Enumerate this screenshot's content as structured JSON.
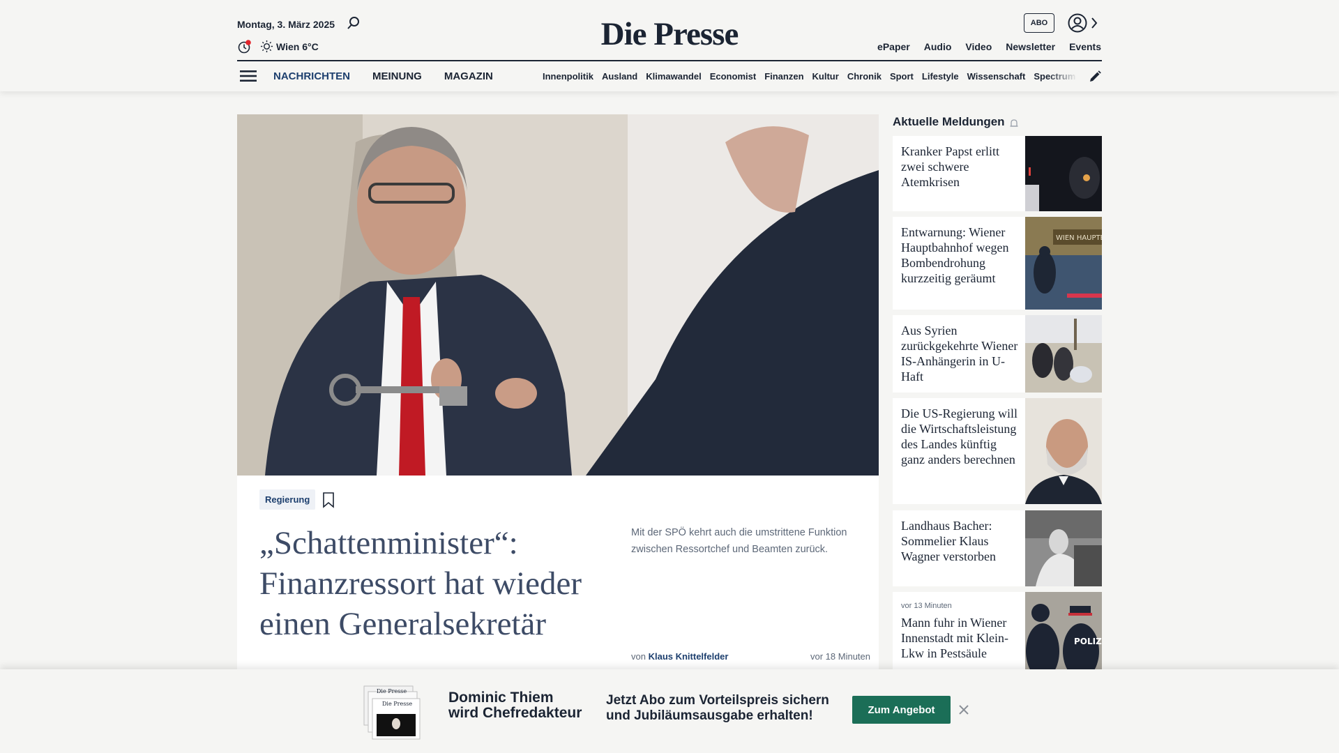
{
  "header": {
    "date": "Montag, 3. März 2025",
    "weather": "Wien 6°C",
    "logo": "Die Presse",
    "abo_label": "ABO",
    "top_links": [
      "ePaper",
      "Audio",
      "Video",
      "Newsletter",
      "Events"
    ],
    "main_nav": [
      "NACHRICHTEN",
      "MEINUNG",
      "MAGAZIN"
    ],
    "sub_nav": [
      "Innenpolitik",
      "Ausland",
      "Klimawandel",
      "Economist",
      "Finanzen",
      "Kultur",
      "Chronik",
      "Sport",
      "Lifestyle",
      "Wissenschaft",
      "Spectrum"
    ],
    "icons": [
      "search-icon",
      "clock-icon",
      "sun-icon",
      "user-icon",
      "chevron-right-icon",
      "menu-icon",
      "pen-icon"
    ]
  },
  "lead": {
    "tag": "Regierung",
    "headline": "„Schattenminister“: Finanzressort hat wieder einen Generalsekretär",
    "teaser": "Mit der SPÖ kehrt auch die umstrittene Funktion zwischen Ressortchef und Beamten zurück.",
    "byline_prefix": "von",
    "author": "Klaus Knittelfelder",
    "time": "vor 18 Minuten"
  },
  "sidebar": {
    "title": "Aktuelle Meldungen",
    "items": [
      {
        "text": "Kranker Papst erlitt zwei schwere Atemkrisen"
      },
      {
        "text": "Entwarnung: Wiener Hauptbahnhof wegen Bombendrohung kurzzeitig geräumt",
        "image_text": "WIEN HAUPTBA"
      },
      {
        "text": "Aus Syrien zurückgekehrte Wiener IS-Anhängerin in U-Haft"
      },
      {
        "text": "Die US-Regierung will die Wirtschaftsleistung des Landes künftig ganz anders berechnen"
      },
      {
        "text": "Landhaus Bacher: Sommelier Klaus Wagner verstorben"
      },
      {
        "meta": "vor 13 Minuten",
        "text": "Mann fuhr in Wiener Innenstadt mit Klein-Lkw in Pestsäule",
        "image_text": "POLIZ"
      }
    ]
  },
  "promo": {
    "name_line1": "Dominic Thiem",
    "name_line2": "wird Chefredakteur",
    "text_line1": "Jetzt Abo zum Vorteilspreis sichern",
    "text_line2": "und Jubiläumsausgabe erhalten!",
    "button": "Zum Angebot",
    "mini_logo": "Die Presse"
  },
  "colors": {
    "background": "#f5f5f3",
    "navy": "#1d3f6e",
    "text": "#1b2433",
    "button_green": "#1b6e57",
    "notification_red": "#e3262c"
  }
}
